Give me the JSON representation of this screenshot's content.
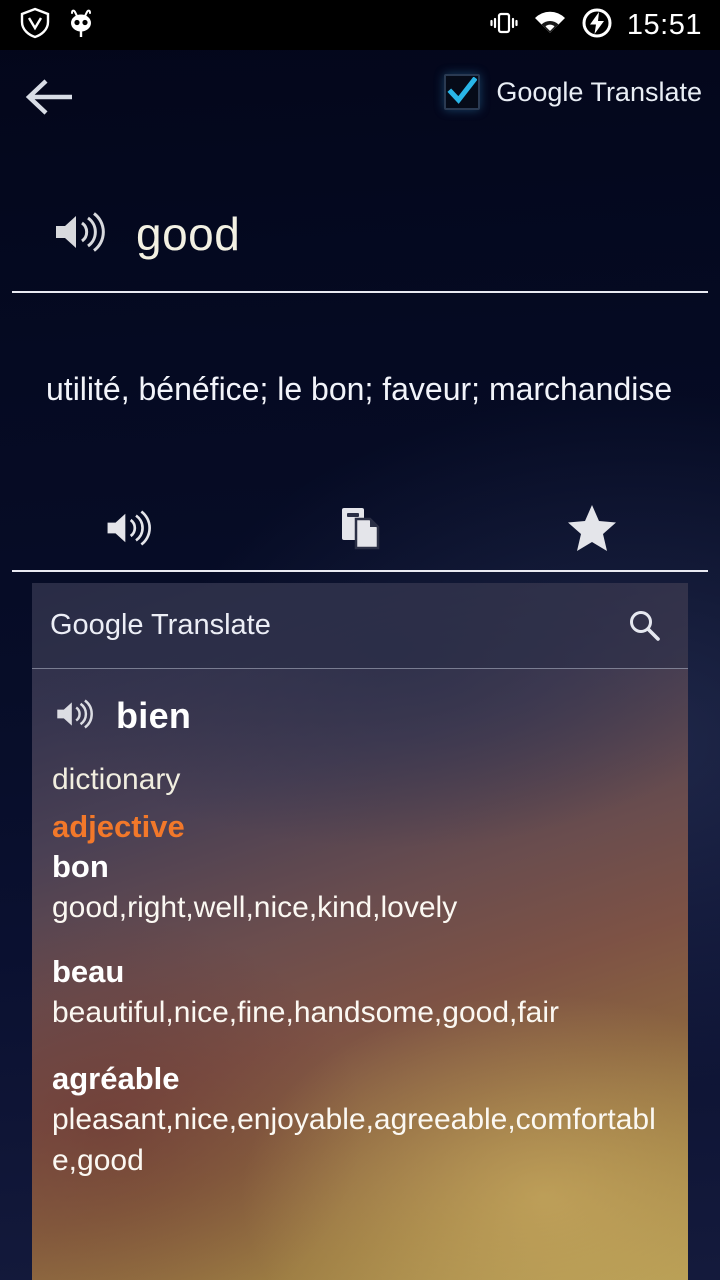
{
  "status_bar": {
    "icons": [
      "shield-icon",
      "cyanogenmod-icon",
      "vibrate-icon",
      "wifi-icon",
      "battery-charging-icon"
    ],
    "time": "15:51"
  },
  "action_bar": {
    "back_icon": "back-arrow-icon",
    "toggle_label": "Google Translate",
    "toggle_checked": true,
    "check_color": "#29b6e8"
  },
  "headword": {
    "speak_icon": "speaker-icon",
    "word": "good"
  },
  "translation": {
    "text": " utilité, bénéfice; le bon; faveur; marchandise"
  },
  "actions": [
    {
      "name": "speak",
      "icon": "speaker-icon"
    },
    {
      "name": "copy",
      "icon": "copy-icon"
    },
    {
      "name": "favorite",
      "icon": "star-icon"
    }
  ],
  "card": {
    "header": {
      "title": "Google Translate",
      "search_icon": "search-icon"
    },
    "result_word": "bien",
    "result_speak_icon": "speaker-icon",
    "section_label": "dictionary",
    "part_of_speech": "adjective",
    "pos_color": "#f2782a",
    "entries": [
      {
        "word": "bon",
        "synonyms": "good,right,well,nice,kind,lovely"
      },
      {
        "word": "beau",
        "synonyms": "beautiful,nice,fine,handsome,good,fair"
      },
      {
        "word": "agréable",
        "synonyms": "pleasant,nice,enjoyable,agreeable,comfortable,good"
      }
    ]
  }
}
